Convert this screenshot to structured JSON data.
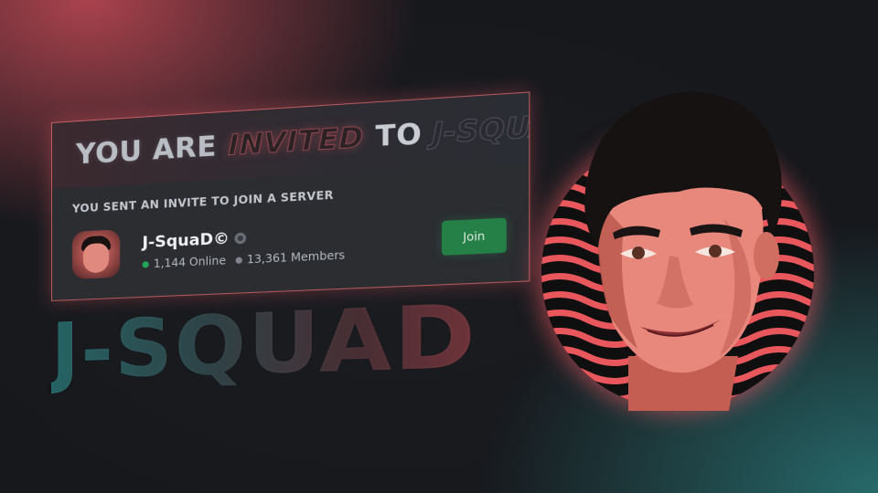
{
  "invite": {
    "headline_part1": "YOU ARE",
    "headline_part2": "INVITED",
    "headline_part3": "TO",
    "headline_part4": "J-SQUAD",
    "label": "YOU SENT AN INVITE TO JOIN A SERVER",
    "server_name": "J-SquaD©",
    "online": "1,144 Online",
    "members": "13,361 Members",
    "join_label": "Join"
  },
  "logo_text": "J-SQUAD",
  "icons": {
    "server": "server-avatar-icon",
    "verified": "verified-icon",
    "online_dot": "online-status-dot",
    "members_dot": "members-status-dot"
  },
  "colors": {
    "join_button": "#248046",
    "online_dot": "#23a55a",
    "card_border": "#e66e73",
    "accent_red": "#c44a56",
    "accent_teal": "#2a7878"
  }
}
